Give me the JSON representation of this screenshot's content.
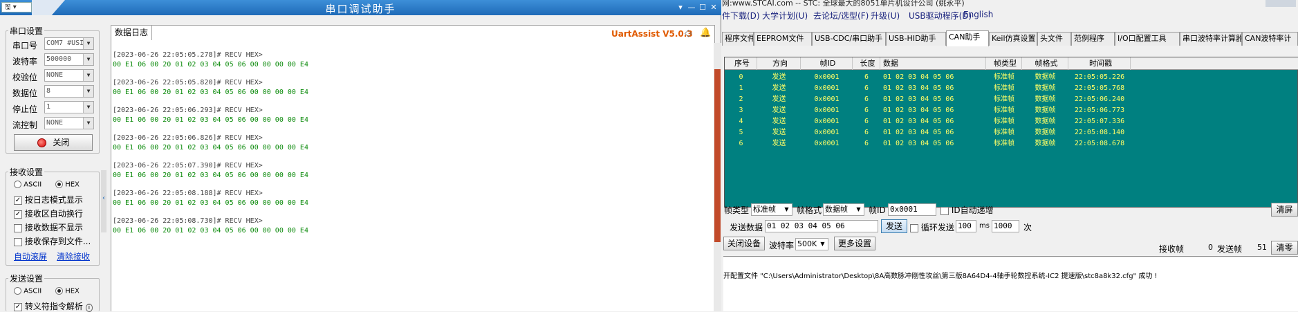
{
  "serial": {
    "title": "串口调试助手",
    "sys_menu": "▾",
    "win_controls": [
      "▾",
      "—",
      "☐",
      "✕"
    ],
    "port_group": {
      "label": "串口设置",
      "fields": [
        {
          "label": "串口号",
          "value": "COM7 #USI"
        },
        {
          "label": "波特率",
          "value": "500000"
        },
        {
          "label": "校验位",
          "value": "NONE"
        },
        {
          "label": "数据位",
          "value": "8"
        },
        {
          "label": "停止位",
          "value": "1"
        },
        {
          "label": "流控制",
          "value": "NONE"
        }
      ],
      "close_button": "关闭"
    },
    "recv_group": {
      "label": "接收设置",
      "ascii": "ASCII",
      "hex": "HEX",
      "checks": [
        {
          "label": "按日志模式显示",
          "checked": true
        },
        {
          "label": "接收区自动换行",
          "checked": true
        },
        {
          "label": "接收数据不显示",
          "checked": false
        },
        {
          "label": "接收保存到文件...",
          "checked": false
        }
      ],
      "auto_clear": "自动滚屏",
      "clear_recv": "清除接收"
    },
    "send_group": {
      "label": "发送设置",
      "ascii": "ASCII",
      "hex": "HEX",
      "escape": "转义符指令解析"
    },
    "log_tab": "数据日志",
    "brand": "UartAssist V5.0.3",
    "log": [
      {
        "head": "[2023-06-26 22:05:05.278]# RECV HEX>",
        "data": "00 E1 06 00 20 01 02 03 04 05 06 00 00 00 00 E4"
      },
      {
        "head": "[2023-06-26 22:05:05.820]# RECV HEX>",
        "data": "00 E1 06 00 20 01 02 03 04 05 06 00 00 00 00 E4"
      },
      {
        "head": "[2023-06-26 22:05:06.293]# RECV HEX>",
        "data": "00 E1 06 00 20 01 02 03 04 05 06 00 00 00 00 E4"
      },
      {
        "head": "[2023-06-26 22:05:06.826]# RECV HEX>",
        "data": "00 E1 06 00 20 01 02 03 04 05 06 00 00 00 00 E4"
      },
      {
        "head": "[2023-06-26 22:05:07.390]# RECV HEX>",
        "data": "00 E1 06 00 20 01 02 03 04 05 06 00 00 00 00 E4"
      },
      {
        "head": "[2023-06-26 22:05:08.188]# RECV HEX>",
        "data": "00 E1 06 00 20 01 02 03 04 05 06 00 00 00 00 E4"
      },
      {
        "head": "[2023-06-26 22:05:08.730]# RECV HEX>",
        "data": "00 E1 06 00 20 01 02 03 04 05 06 00 00 00 00 E4"
      }
    ]
  },
  "stc": {
    "topline": "网:www.STCAI.com -- STC: 全球最大的8051单片机设计公司 (姚永平)",
    "menu": [
      "件下载(D)",
      "大学计划(U)",
      "去论坛/选型(F)",
      "升级(U)",
      "USB驱动程序(D)",
      "English"
    ],
    "tabs": [
      "程序文件",
      "EEPROM文件",
      "USB-CDC/串口助手",
      "USB-HID助手",
      "CAN助手",
      "Keil仿真设置",
      "头文件",
      "范例程序",
      "I/O口配置工具",
      "串口波特率计算器",
      "CAN波特率计"
    ],
    "active_tab": 4,
    "columns": [
      "序号",
      "方向",
      "帧ID",
      "长度",
      "数据",
      "帧类型",
      "帧格式",
      "时间戳"
    ],
    "rows": [
      [
        "0",
        "发送",
        "0x0001",
        "6",
        "01 02 03 04 05 06",
        "标准帧",
        "数据帧",
        "22:05:05.226"
      ],
      [
        "1",
        "发送",
        "0x0001",
        "6",
        "01 02 03 04 05 06",
        "标准帧",
        "数据帧",
        "22:05:05.768"
      ],
      [
        "2",
        "发送",
        "0x0001",
        "6",
        "01 02 03 04 05 06",
        "标准帧",
        "数据帧",
        "22:05:06.240"
      ],
      [
        "3",
        "发送",
        "0x0001",
        "6",
        "01 02 03 04 05 06",
        "标准帧",
        "数据帧",
        "22:05:06.773"
      ],
      [
        "4",
        "发送",
        "0x0001",
        "6",
        "01 02 03 04 05 06",
        "标准帧",
        "数据帧",
        "22:05:07.336"
      ],
      [
        "5",
        "发送",
        "0x0001",
        "6",
        "01 02 03 04 05 06",
        "标准帧",
        "数据帧",
        "22:05:08.140"
      ],
      [
        "6",
        "发送",
        "0x0001",
        "6",
        "01 02 03 04 05 06",
        "标准帧",
        "数据帧",
        "22:05:08.678"
      ]
    ],
    "controls": {
      "frame_type_label": "帧类型",
      "frame_type": "标准帧",
      "frame_format_label": "帧格式",
      "frame_format": "数据帧",
      "frame_id_label": "帧ID",
      "frame_id": "0x0001",
      "id_auto_inc": "ID自动递增",
      "clear_btn": "清屏",
      "send_data_label": "发送数据",
      "send_data": "01 02 03 04 05 06",
      "send_btn": "发送",
      "loop_send": "循环发送",
      "loop_ms": "100",
      "ms": "ms",
      "loop_count": "1000",
      "times": "次",
      "close_device": "关闭设备",
      "baud_label": "波特率",
      "baud": "500K",
      "more_settings": "更多设置",
      "recv_frames_label": "接收帧",
      "recv_frames": "0",
      "sent_frames_label": "发送帧",
      "sent_frames": "51",
      "clear_zero": "清零"
    },
    "status": "开配置文件 \"C:\\Users\\Administrator\\Desktop\\8A高数脉冲刚性攻丝\\第三版8A64D4-4轴手轮数控系统-IC2 提速版\\stc8a8k32.cfg\" 成功 !"
  }
}
